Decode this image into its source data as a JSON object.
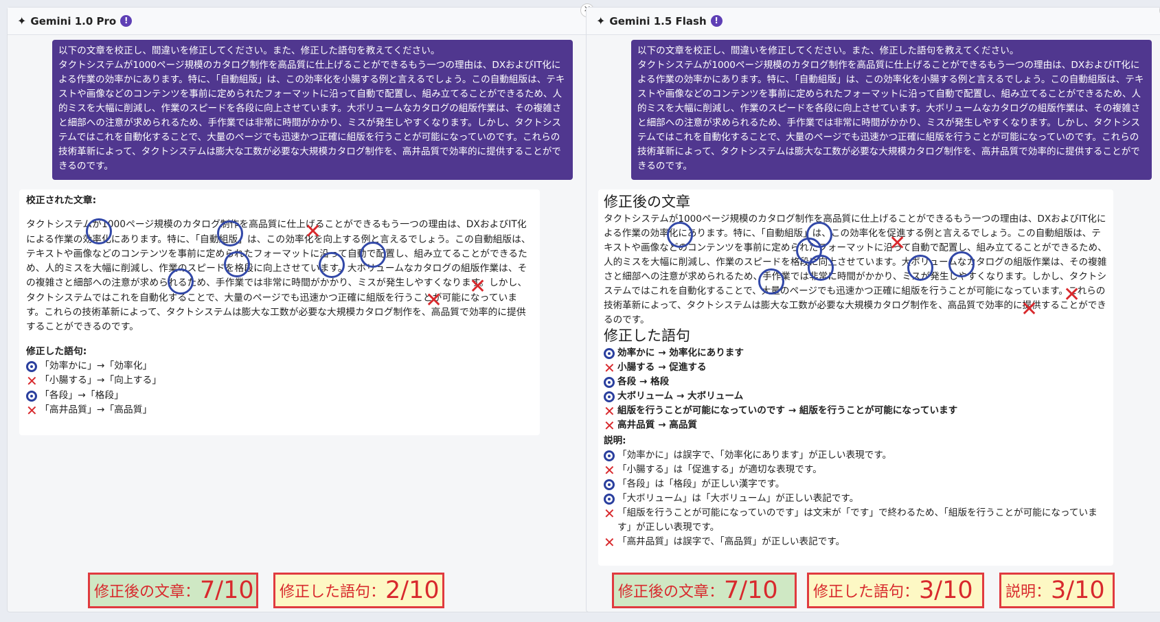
{
  "left": {
    "model": "Gemini 1.0 Pro",
    "info_icon": "!",
    "close_icon": "×",
    "prompt": [
      "以下の文章を校正し、間違いを修正してください。また、修正した語句を教えてください。",
      "タクトシステムが1000ページ規模のカタログ制作を高品質に仕上げることができるもう一つの理由は、DXおよびIT化による作業の効率かにあります。特に、「自動組版」は、この効率化を小腸する例と言えるでしょう。この自動組版は、テキストや画像などのコンテンツを事前に定められたフォーマットに沿って自動で配置し、組み立てることができるため、人的ミスを大幅に削減し、作業のスピードを各段に向上させています。大ボリュームなカタログの組版作業は、その複雑さと細部への注意が求められるため、手作業では非常に時間がかかり、ミスが発生しやすくなります。しかし、タクトシステムではこれを自動化することで、大量のページでも迅速かつ正確に組版を行うことが可能になっていのです。これらの技術革新によって、タクトシステムは膨大な工数が必要な大規模カタログ制作を、高井品質で効率的に提供することができるのです。"
    ],
    "response": {
      "heading": "校正された文章:",
      "body": "タクトシステムが1000ページ規模のカタログ制作を高品質に仕上げることができるもう一つの理由は、DXおよびIT化による作業の効率化にあります。特に、「自動組版」は、この効率化を向上する例と言えるでしょう。この自動組版は、テキストや画像などのコンテンツを事前に定められたフォーマットに沿って自動で配置し、組み立てることができるため、人的ミスを大幅に削減し、作業のスピードを格段に向上させています。大ボリュームなカタログの組版作業は、その複雑さと細部への注意が求められるため、手作業では非常に時間がかかり、ミスが発生しやすくなります。しかし、タクトシステムではこれを自動化することで、大量のページでも迅速かつ正確に組版を行うことが可能になっています。これらの技術革新によって、タクトシステムは膨大な工数が必要な大規模カタログ制作を、高品質で効率的に提供することができるのです。",
      "corrections_heading": "修正した語句:",
      "corrections": [
        {
          "mark": "good",
          "text": "「効率かに」→「効率化」"
        },
        {
          "mark": "bad",
          "text": "「小腸する」→「向上する」"
        },
        {
          "mark": "good",
          "text": "「各段」→「格段」"
        },
        {
          "mark": "bad",
          "text": "「高井品質」→「高品質」"
        }
      ]
    },
    "scores": [
      {
        "label": "修正後の文章：",
        "value": "7/10",
        "style": "green"
      },
      {
        "label": "修正した語句：",
        "value": "2/10",
        "style": "yellow"
      }
    ]
  },
  "right": {
    "model": "Gemini 1.5 Flash",
    "info_icon": "!",
    "close_icon": "×",
    "prompt": [
      "以下の文章を校正し、間違いを修正してください。また、修正した語句を教えてください。",
      "タクトシステムが1000ページ規模のカタログ制作を高品質に仕上げることができるもう一つの理由は、DXおよびIT化による作業の効率かにあります。特に、「自動組版」は、この効率化を小腸する例と言えるでしょう。この自動組版は、テキストや画像などのコンテンツを事前に定められたフォーマットに沿って自動で配置し、組み立てることができるため、人的ミスを大幅に削減し、作業のスピードを各段に向上させています。大ボリュームなカタログの組版作業は、その複雑さと細部への注意が求められるため、手作業では非常に時間がかかり、ミスが発生しやすくなります。しかし、タクトシステムではこれを自動化することで、大量のページでも迅速かつ正確に組版を行うことが可能になっていのです。これらの技術革新によって、タクトシステムは膨大な工数が必要な大規模カタログ制作を、高井品質で効率的に提供することができるのです。"
    ],
    "response": {
      "heading": "修正後の文章",
      "body": "タクトシステムが1000ページ規模のカタログ制作を高品質に仕上げることができるもう一つの理由は、DXおよびIT化による作業の効率化にあります。特に、「自動組版」は、この効率化を促進する例と言えるでしょう。この自動組版は、テキストや画像などのコンテンツを事前に定められたフォーマットに沿って自動で配置し、組み立てることができるため、人的ミスを大幅に削減し、作業のスピードを格段に向上させています。大ボリュームなカタログの組版作業は、その複雑さと細部への注意が求められるため、手作業では非常に時間がかかり、ミスが発生しやすくなります。しかし、タクトシステムではこれを自動化することで、大量のページでも迅速かつ正確に組版を行うことが可能になっています。これらの技術革新によって、タクトシステムは膨大な工数が必要な大規模カタログ制作を、高品質で効率的に提供することができるのです。",
      "corrections_heading": "修正した語句",
      "corrections": [
        {
          "mark": "good",
          "text": "効率かに → 効率化にあります"
        },
        {
          "mark": "bad",
          "text": "小腸する → 促進する"
        },
        {
          "mark": "good",
          "text": "各段 → 格段"
        },
        {
          "mark": "good",
          "text": "大ボリューム → 大ボリューム"
        },
        {
          "mark": "bad",
          "text": "組版を行うことが可能になっていのです → 組版を行うことが可能になっています"
        },
        {
          "mark": "bad",
          "text": "高井品質 → 高品質"
        }
      ],
      "explanation_heading": "説明:",
      "explanations": [
        {
          "mark": "good",
          "text": "「効率かに」は誤字で、「効率化にあります」が正しい表現です。"
        },
        {
          "mark": "bad",
          "text": "「小腸する」は「促進する」が適切な表現です。"
        },
        {
          "mark": "good",
          "text": "「各段」は「格段」が正しい漢字です。"
        },
        {
          "mark": "good",
          "text": "「大ボリューム」は「大ボリューム」が正しい表記です。"
        },
        {
          "mark": "bad",
          "text": "「組版を行うことが可能になっていのです」は文末が「です」で終わるため、「組版を行うことが可能になっています」が正しい表現です。"
        },
        {
          "mark": "bad",
          "text": "「高井品質」は誤字で、「高品質」が正しい表記です。"
        }
      ]
    },
    "scores": [
      {
        "label": "修正後の文章：",
        "value": "7/10",
        "style": "green"
      },
      {
        "label": "修正した語句：",
        "value": "3/10",
        "style": "yellow"
      },
      {
        "label": "説明：",
        "value": "3/10",
        "style": "yellow"
      }
    ]
  }
}
